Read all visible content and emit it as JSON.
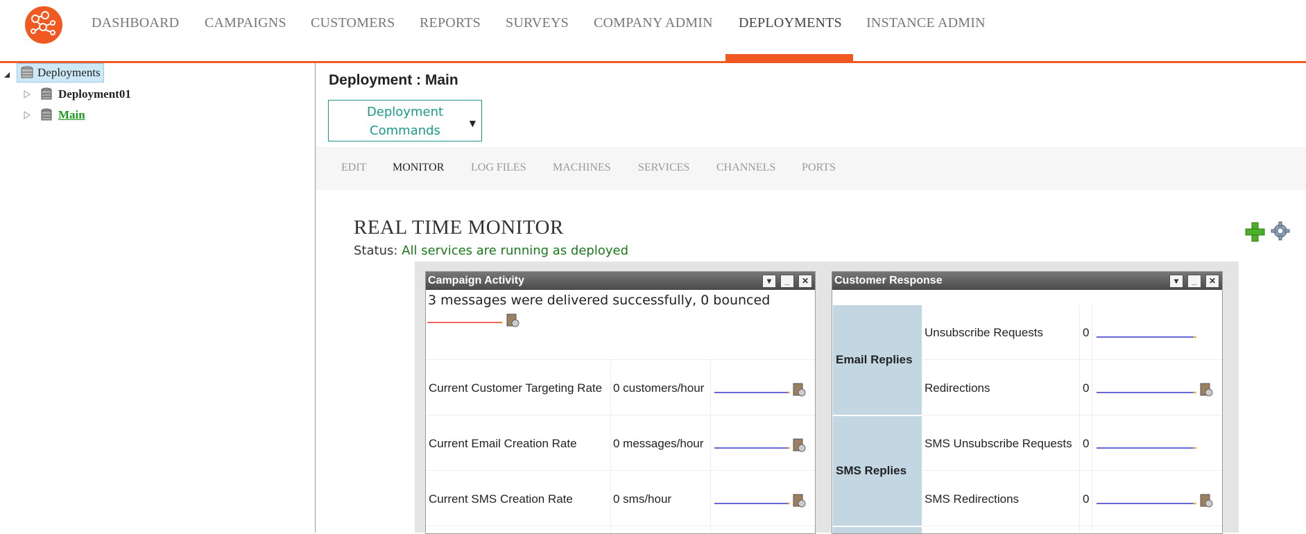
{
  "nav": {
    "items": [
      "DASHBOARD",
      "CAMPAIGNS",
      "CUSTOMERS",
      "REPORTS",
      "SURVEYS",
      "COMPANY ADMIN",
      "DEPLOYMENTS",
      "INSTANCE ADMIN"
    ],
    "active": "DEPLOYMENTS",
    "accent_color": "#f05a22"
  },
  "tree": {
    "root": "Deployments",
    "children": [
      "Deployment01",
      "Main"
    ],
    "selected": "Main"
  },
  "main": {
    "title": "Deployment : Main",
    "commands_label_line1": "Deployment",
    "commands_label_line2": "Commands",
    "caret": "▼",
    "tabs": [
      "EDIT",
      "MONITOR",
      "LOG FILES",
      "MACHINES",
      "SERVICES",
      "CHANNELS",
      "PORTS"
    ],
    "active_tab": "MONITOR"
  },
  "monitor": {
    "title": "REAL TIME MONITOR",
    "status_label": "Status:",
    "status_value": "All services are running as deployed",
    "status_color": "#1a7a1a"
  },
  "campaign_activity": {
    "title": "Campaign Activity",
    "message": "3 messages were delivered successfully, 0 bounced",
    "rows": [
      {
        "label": "Current Customer Targeting Rate",
        "value": "0 customers/hour"
      },
      {
        "label": "Current Email Creation Rate",
        "value": "0 messages/hour"
      },
      {
        "label": "Current SMS Creation Rate",
        "value": "0 sms/hour"
      }
    ]
  },
  "customer_response": {
    "title": "Customer Response",
    "groups": [
      {
        "name": "Email Replies",
        "rows": [
          {
            "label": "Unsubscribe Requests",
            "value": "0"
          },
          {
            "label": "Redirections",
            "value": "0"
          }
        ]
      },
      {
        "name": "SMS Replies",
        "rows": [
          {
            "label": "SMS Unsubscribe Requests",
            "value": "0"
          },
          {
            "label": "SMS Redirections",
            "value": "0"
          }
        ]
      }
    ]
  },
  "panel_buttons": {
    "dropdown": "▾",
    "minimize": "_",
    "close": "✕"
  }
}
